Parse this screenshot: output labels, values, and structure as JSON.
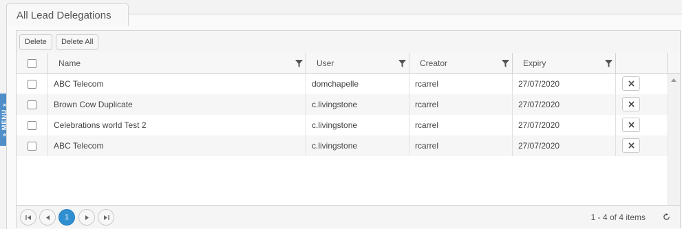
{
  "menu": {
    "label": "» MENU »"
  },
  "panel": {
    "title": "All Lead Delegations"
  },
  "toolbar": {
    "delete_label": "Delete",
    "delete_all_label": "Delete All"
  },
  "columns": [
    {
      "label": "Name"
    },
    {
      "label": "User"
    },
    {
      "label": "Creator"
    },
    {
      "label": "Expiry"
    }
  ],
  "rows": [
    {
      "name": "ABC Telecom",
      "user": "domchapelle",
      "creator": "rcarrel",
      "expiry": "27/07/2020"
    },
    {
      "name": "Brown Cow Duplicate",
      "user": "c.livingstone",
      "creator": "rcarrel",
      "expiry": "27/07/2020"
    },
    {
      "name": "Celebrations world Test 2",
      "user": "c.livingstone",
      "creator": "rcarrel",
      "expiry": "27/07/2020"
    },
    {
      "name": "ABC Telecom",
      "user": "c.livingstone",
      "creator": "rcarrel",
      "expiry": "27/07/2020"
    }
  ],
  "pager": {
    "current_page": "1",
    "info": "1 - 4 of 4 items"
  },
  "colors": {
    "accent": "#2f8fd1",
    "menu_tab": "#4f8ec9"
  },
  "icons": [
    "filter-icon",
    "close-icon",
    "first-page-icon",
    "prev-page-icon",
    "next-page-icon",
    "last-page-icon",
    "refresh-icon",
    "scroll-up-icon"
  ]
}
